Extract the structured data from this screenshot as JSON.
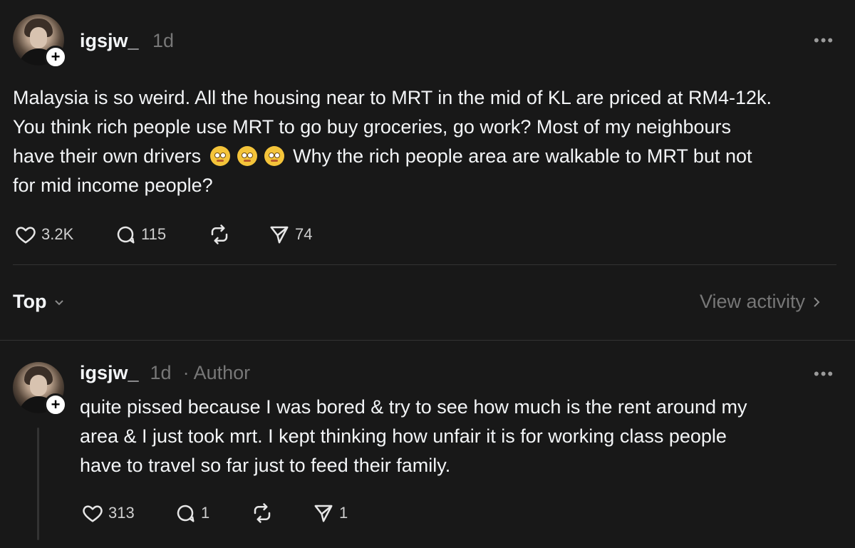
{
  "post": {
    "username": "igsjw_",
    "time": "1d",
    "text_line1": "Malaysia is so weird. All the housing near to MRT in the mid of KL are priced at RM4-12k.",
    "text_line2": "You think rich people use MRT to go buy groceries, go work? Most of my neighbours",
    "text_line3_a": "have their own drivers",
    "text_line3_b": "Why the rich people area are walkable to MRT but not",
    "text_line4": "for mid income people?",
    "emojis": [
      "flushed-face",
      "flushed-face",
      "flushed-face"
    ],
    "likes": "3.2K",
    "comments": "115",
    "shares": "74"
  },
  "sort": {
    "label": "Top",
    "view_activity": "View activity"
  },
  "reply": {
    "username": "igsjw_",
    "time": "1d",
    "author_badge": "· Author",
    "text_line1": "quite pissed because I was bored & try to see how much is the rent around my",
    "text_line2": "area & I just took mrt. I kept thinking how unfair it is for working class people",
    "text_line3": "have to travel so far just to feed their family.",
    "likes": "313",
    "comments": "1",
    "shares": "1"
  },
  "icons": {
    "more": "more-horizontal-icon",
    "heart": "heart-icon",
    "comment": "comment-icon",
    "repost": "repost-icon",
    "share": "send-icon",
    "follow": "plus-icon"
  },
  "colors": {
    "background": "#181818",
    "text": "#f3f5f7",
    "muted": "#777777",
    "divider": "#333333"
  }
}
